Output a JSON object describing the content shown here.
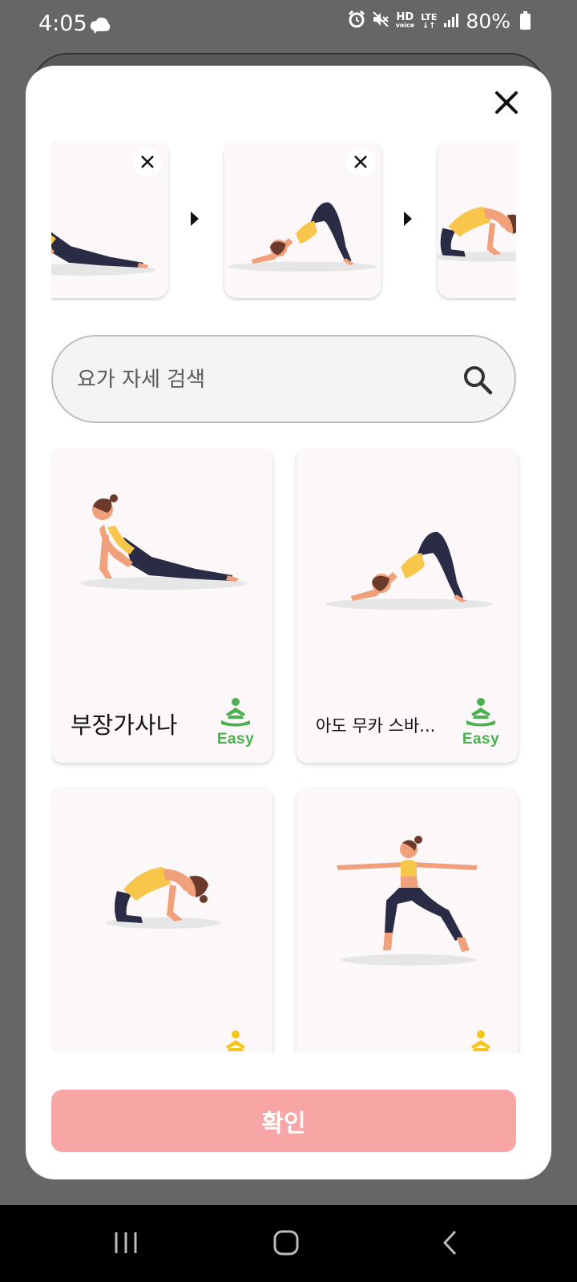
{
  "status_bar": {
    "time": "4:05",
    "battery": "80%",
    "icons": [
      "chat-cloud-icon",
      "alarm-icon",
      "mute-icon",
      "hd-voice-icon",
      "lte-icon",
      "signal-icon",
      "battery-icon"
    ],
    "hd_label": "HD",
    "hd_sub": "voice",
    "lte_label": "LTE"
  },
  "sheet": {
    "close_icon": "close-icon",
    "sequence": [
      {
        "pose": "cobra",
        "remove_icon": "close-icon"
      },
      {
        "pose": "downward-dog",
        "remove_icon": "close-icon"
      },
      {
        "pose": "camel"
      }
    ],
    "search": {
      "placeholder": "요가 자세 검색",
      "value": "",
      "icon": "search-icon"
    },
    "poses": [
      {
        "name": "부장가사나",
        "difficulty": "Easy",
        "difficulty_color": "#4caf50",
        "illustration": "cobra"
      },
      {
        "name": "아도 무카 스바...",
        "difficulty": "Easy",
        "difficulty_color": "#4caf50",
        "illustration": "downward-dog"
      },
      {
        "name": "",
        "difficulty": "",
        "difficulty_color": "#f5c518",
        "illustration": "camel"
      },
      {
        "name": "",
        "difficulty": "",
        "difficulty_color": "#f5c518",
        "illustration": "warrior-two"
      }
    ],
    "confirm_label": "확인",
    "confirm_color": "#f7a5a5"
  },
  "nav_bar": {
    "buttons": [
      "recent-apps-icon",
      "home-icon",
      "back-icon"
    ]
  },
  "colors": {
    "skin": "#f0a07a",
    "top": "#f7c64a",
    "pants": "#2a2b45",
    "hair": "#6b3a2a",
    "shadow": "#e6e6e6"
  }
}
